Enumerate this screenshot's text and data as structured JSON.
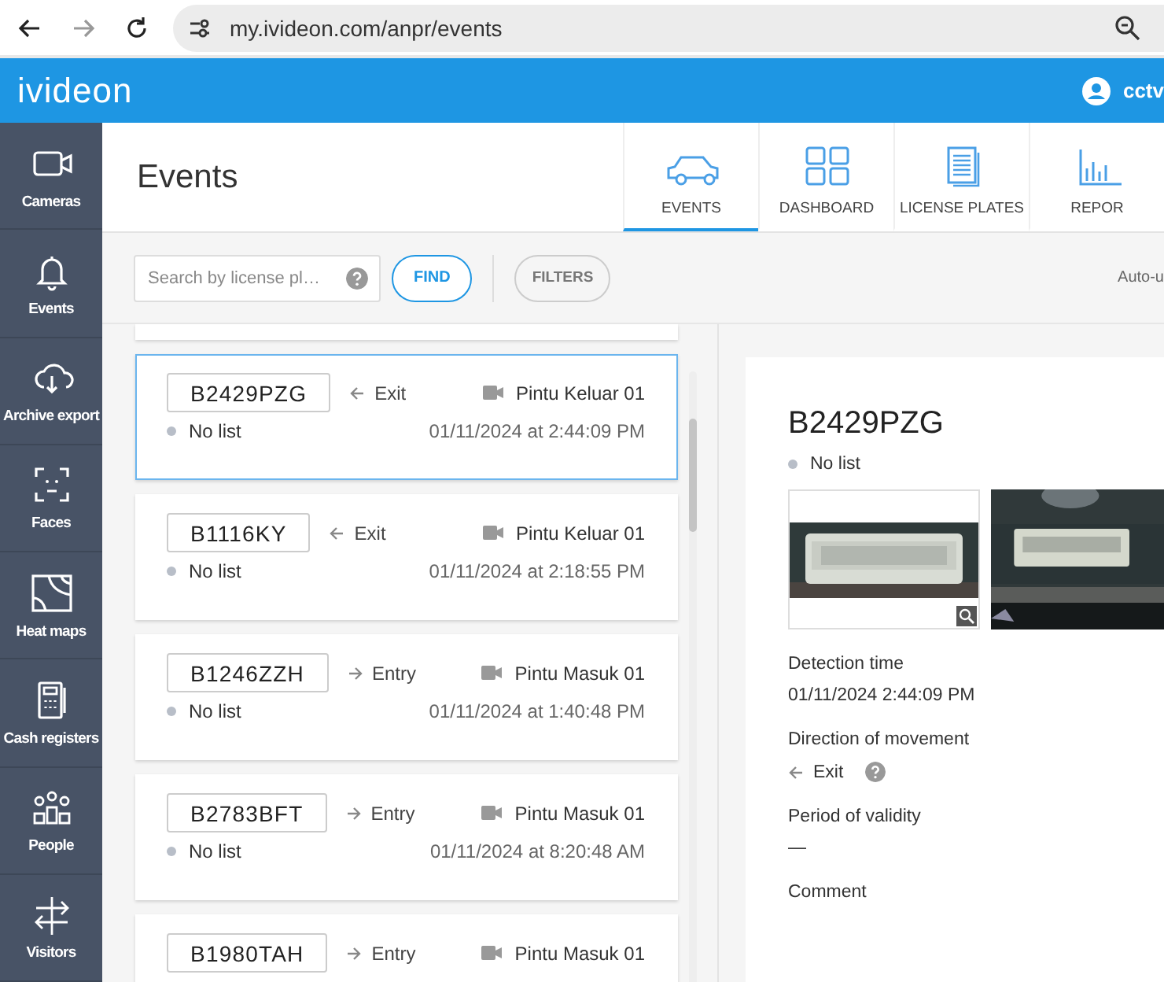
{
  "browser": {
    "url": "my.ivideon.com/anpr/events"
  },
  "header": {
    "logo": "ivideon",
    "user": "cctv"
  },
  "sidebar": {
    "items": [
      {
        "label": "Cameras",
        "kind": "camera"
      },
      {
        "label": "Events",
        "kind": "bell"
      },
      {
        "label": "Archive export",
        "kind": "cloud"
      },
      {
        "label": "Faces",
        "kind": "face"
      },
      {
        "label": "Heat maps",
        "kind": "heatmap"
      },
      {
        "label": "Cash registers",
        "kind": "register"
      },
      {
        "label": "People",
        "kind": "people"
      },
      {
        "label": "Visitors",
        "kind": "visitors"
      }
    ]
  },
  "page": {
    "title": "Events",
    "tabs": [
      {
        "label": "EVENTS",
        "kind": "car",
        "selected": true
      },
      {
        "label": "DASHBOARD",
        "kind": "grid",
        "selected": false
      },
      {
        "label": "LICENSE PLATES",
        "kind": "doc",
        "selected": false
      },
      {
        "label": "REPOR",
        "kind": "chart",
        "selected": false
      }
    ]
  },
  "toolbar": {
    "search": {
      "placeholder": "Search by license pl…"
    },
    "find": "FIND",
    "filters": "FILTERS",
    "auto": "Auto-u"
  },
  "events": [
    {
      "plate": "B2429PZG",
      "kind": "exit",
      "direction": "Exit",
      "camera": "Pintu Keluar 01",
      "list": "No list",
      "time": "01/11/2024 at 2:44:09 PM",
      "selected": true
    },
    {
      "plate": "B1116KY",
      "kind": "exit",
      "direction": "Exit",
      "camera": "Pintu Keluar 01",
      "list": "No list",
      "time": "01/11/2024 at 2:18:55 PM",
      "selected": false
    },
    {
      "plate": "B1246ZZH",
      "kind": "entry",
      "direction": "Entry",
      "camera": "Pintu Masuk 01",
      "list": "No list",
      "time": "01/11/2024 at 1:40:48 PM",
      "selected": false
    },
    {
      "plate": "B2783BFT",
      "kind": "entry",
      "direction": "Entry",
      "camera": "Pintu Masuk 01",
      "list": "No list",
      "time": "01/11/2024 at 8:20:48 AM",
      "selected": false
    },
    {
      "plate": "B1980TAH",
      "kind": "entry",
      "direction": "Entry",
      "camera": "Pintu Masuk 01",
      "selected": false
    }
  ],
  "detail": {
    "plate": "B2429PZG",
    "list": "No list",
    "fields": [
      {
        "label": "Detection time",
        "value": "01/11/2024 2:44:09 PM"
      },
      {
        "label": "Direction of movement",
        "value": "Exit",
        "kind": "exit"
      },
      {
        "label": "Period of validity",
        "value": "—"
      },
      {
        "label": "Comment"
      }
    ]
  }
}
